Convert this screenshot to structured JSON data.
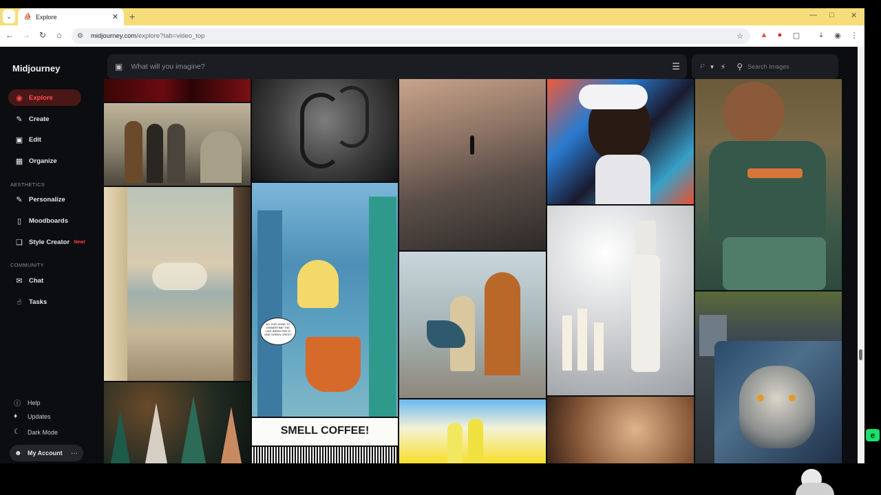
{
  "browser": {
    "tab_title": "Explore",
    "url_host": "midjourney.com",
    "url_path": "/explore?tab=video_top",
    "new_tab_symbol": "+",
    "close_symbol": "✕"
  },
  "sidebar": {
    "brand": "Midjourney",
    "main_items": [
      {
        "label": "Explore",
        "icon": "compass-icon"
      },
      {
        "label": "Create",
        "icon": "brush-icon"
      },
      {
        "label": "Edit",
        "icon": "edit-icon"
      },
      {
        "label": "Organize",
        "icon": "grid-icon"
      }
    ],
    "aesthetics_heading": "AESTHETICS",
    "aesthetics_items": [
      {
        "label": "Personalize",
        "icon": "brush-icon"
      },
      {
        "label": "Moodboards",
        "icon": "moodboard-icon"
      },
      {
        "label": "Style Creator",
        "icon": "palette-icon",
        "badge": "New!"
      }
    ],
    "community_heading": "COMMUNITY",
    "community_items": [
      {
        "label": "Chat",
        "icon": "chat-icon"
      },
      {
        "label": "Tasks",
        "icon": "thumbs-up-icon"
      }
    ],
    "footer_items": [
      {
        "label": "Help",
        "icon": "help-icon"
      },
      {
        "label": "Updates",
        "icon": "bell-icon"
      },
      {
        "label": "Dark Mode",
        "icon": "moon-icon"
      }
    ],
    "account_label": "My Account",
    "account_more": "···"
  },
  "prompt": {
    "placeholder": "What will you imagine?"
  },
  "search": {
    "param_letter": "P",
    "placeholder": "Search Images"
  },
  "gallery": {
    "comic_caption": "SMELL COFFEE!",
    "comic_bubble": "MY FOR GONE TO DINNERTIME THE LIKE INDRA PRE IS ONE GREEN CREST!"
  },
  "colors": {
    "accent": "#ff4d4d",
    "active_bg": "#4a1717",
    "page_bg": "#0c0d10",
    "tab_strip": "#f6dd7a"
  }
}
